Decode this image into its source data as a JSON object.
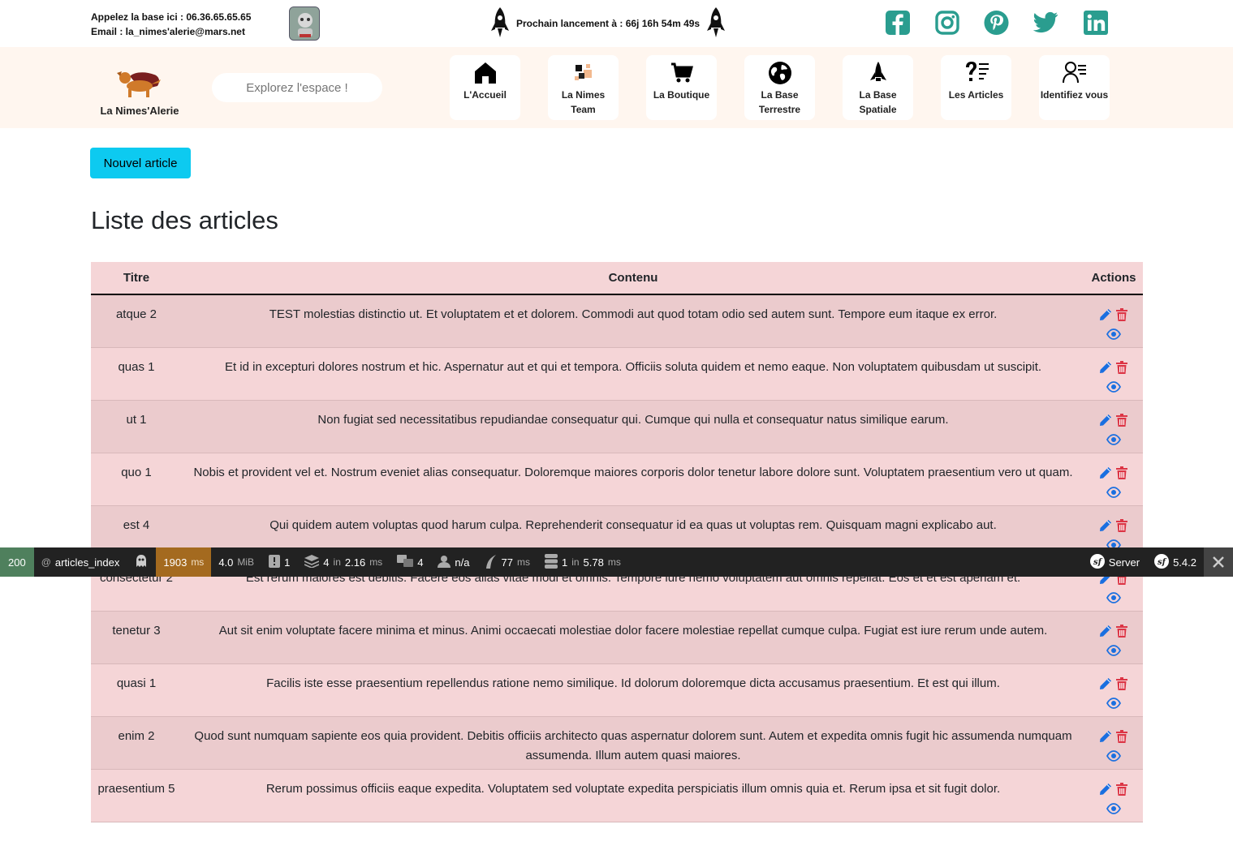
{
  "topbar": {
    "phone_line": "Appelez la base ici : 06.36.65.65.65",
    "email_line": "Email : la_nimes'alerie@mars.net",
    "launch_text": "Prochain lancement à : 66j 16h 54m 49s",
    "socials": [
      "facebook-icon",
      "instagram-icon",
      "pinterest-icon",
      "twitter-icon",
      "linkedin-icon"
    ],
    "social_color": "#2a9d8f"
  },
  "navbar": {
    "brand": "La Nimes'Alerie",
    "search_placeholder": "Explorez l'espace !",
    "items": [
      {
        "label": "L'Accueil",
        "icon": "home-icon"
      },
      {
        "label": "La Nimes Team",
        "icon": "team-icon"
      },
      {
        "label": "La Boutique",
        "icon": "cart-icon"
      },
      {
        "label": "La Base Terrestre",
        "icon": "earth-icon"
      },
      {
        "label": "La Base Spatiale",
        "icon": "shuttle-icon"
      },
      {
        "label": "Les Articles",
        "icon": "articles-icon"
      },
      {
        "label": "Identifiez vous",
        "icon": "user-icon"
      }
    ]
  },
  "main": {
    "new_button": "Nouvel article",
    "title": "Liste des articles",
    "headers": {
      "title": "Titre",
      "content": "Contenu",
      "actions": "Actions"
    },
    "rows": [
      {
        "title": "atque 2",
        "content": "TEST molestias distinctio ut. Et voluptatem et et dolorem. Commodi aut quod totam odio sed autem sunt. Tempore eum itaque ex error."
      },
      {
        "title": "quas 1",
        "content": "Et id in excepturi dolores nostrum et hic. Aspernatur aut et qui et tempora. Officiis soluta quidem et nemo eaque. Non voluptatem quibusdam ut suscipit."
      },
      {
        "title": "ut 1",
        "content": "Non fugiat sed necessitatibus repudiandae consequatur qui. Cumque qui nulla et consequatur natus similique earum."
      },
      {
        "title": "quo 1",
        "content": "Nobis et provident vel et. Nostrum eveniet alias consequatur. Doloremque maiores corporis dolor tenetur labore dolore sunt. Voluptatem praesentium vero ut quam."
      },
      {
        "title": "est 4",
        "content": "Qui quidem autem voluptas quod harum culpa. Reprehenderit consequatur id ea quas ut voluptas rem. Quisquam magni explicabo aut."
      },
      {
        "title": "consectetur 2",
        "content": "Est rerum maiores est debitis. Facere eos alias vitae modi et omnis. Tempore iure nemo voluptatem aut omnis repellat. Eos et et est aperiam et."
      },
      {
        "title": "tenetur 3",
        "content": "Aut sit enim voluptate facere minima et minus. Animi occaecati molestiae dolor facere molestiae repellat cumque culpa. Fugiat est iure rerum unde autem."
      },
      {
        "title": "quasi 1",
        "content": "Facilis iste esse praesentium repellendus ratione nemo similique. Id dolorum doloremque dicta accusamus praesentium. Et est qui illum."
      },
      {
        "title": "enim 2",
        "content": "Quod sunt numquam sapiente eos quia provident. Debitis officiis architecto quas aspernatur dolorem sunt. Autem et expedita omnis fugit hic assumenda numquam assumenda. Illum autem quasi maiores."
      },
      {
        "title": "praesentium 5",
        "content": "Rerum possimus officiis eaque expedita. Voluptatem sed voluptate expedita perspiciatis illum omnis quia et. Rerum ipsa et sit fugit dolor."
      }
    ],
    "edit_color": "#1a6fe0",
    "delete_color": "#dc3545",
    "view_color": "#1a6fe0"
  },
  "debug": {
    "status": "200",
    "route_prefix": "@",
    "route": "articles_index",
    "time_value": "1903",
    "time_unit": "ms",
    "memory_value": "4.0",
    "memory_unit": "MiB",
    "logs": "1",
    "cache_value": "4",
    "cache_in": "in",
    "cache_time": "2.16",
    "cache_unit": "ms",
    "translations": "4",
    "user": "n/a",
    "twig_value": "77",
    "twig_unit": "ms",
    "db_value": "1",
    "db_in": "in",
    "db_time": "5.78",
    "db_unit": "ms",
    "server": "Server",
    "version": "5.4.2"
  }
}
